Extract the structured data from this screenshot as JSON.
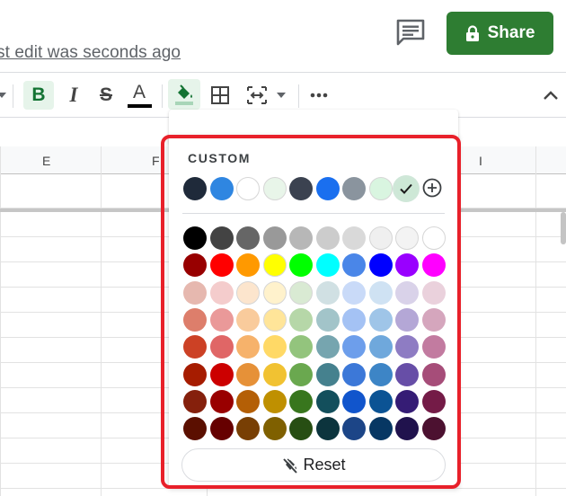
{
  "header": {
    "last_edit": "st edit was seconds ago",
    "share_label": "Share"
  },
  "toolbar": {
    "bold": "B",
    "italic": "I",
    "strikethrough": "S",
    "text_color_letter": "A"
  },
  "sheet": {
    "columns": [
      "E",
      "F",
      "I"
    ]
  },
  "color_menu": {
    "custom_label": "CUSTOM",
    "custom_colors": [
      "#1f2a3a",
      "#2f86e1",
      "#ffffff",
      "#e8f5e9",
      "#3b4250",
      "#1a6fef",
      "#8a949e",
      "#d9f5e0",
      "#cde8d6"
    ],
    "selected_custom_index": 8,
    "palette": [
      [
        "#000000",
        "#434343",
        "#666666",
        "#999999",
        "#b7b7b7",
        "#cccccc",
        "#d9d9d9",
        "#efefef",
        "#f3f3f3",
        "#ffffff"
      ],
      [
        "#980000",
        "#ff0000",
        "#ff9900",
        "#ffff00",
        "#00ff00",
        "#00ffff",
        "#4a86e8",
        "#0000ff",
        "#9900ff",
        "#ff00ff"
      ],
      [
        "#e6b8af",
        "#f4cccc",
        "#fce5cd",
        "#fff2cc",
        "#d9ead3",
        "#d0e0e3",
        "#c9daf8",
        "#cfe2f3",
        "#d9d2e9",
        "#ead1dc"
      ],
      [
        "#dd7e6b",
        "#ea9999",
        "#f9cb9c",
        "#ffe599",
        "#b6d7a8",
        "#a2c4c9",
        "#a4c2f4",
        "#9fc5e8",
        "#b4a7d6",
        "#d5a6bd"
      ],
      [
        "#cc4125",
        "#e06666",
        "#f6b26b",
        "#ffd966",
        "#93c47d",
        "#76a5af",
        "#6d9eeb",
        "#6fa8dc",
        "#8e7cc3",
        "#c27ba0"
      ],
      [
        "#a61c00",
        "#cc0000",
        "#e69138",
        "#f1c232",
        "#6aa84f",
        "#45818e",
        "#3c78d8",
        "#3d85c6",
        "#674ea7",
        "#a64d79"
      ],
      [
        "#85200c",
        "#990000",
        "#b45f06",
        "#bf9000",
        "#38761d",
        "#134f5c",
        "#1155cc",
        "#0b5394",
        "#351c75",
        "#741b47"
      ],
      [
        "#5b0f00",
        "#660000",
        "#783f04",
        "#7f6000",
        "#274e13",
        "#0c343d",
        "#1c4587",
        "#073763",
        "#20124d",
        "#4c1130"
      ]
    ],
    "reset_label": "Reset"
  },
  "colors": {
    "share_bg": "#2e7d32",
    "active_tool_bg": "#e6f4ea",
    "highlight_border": "#e8202a"
  }
}
